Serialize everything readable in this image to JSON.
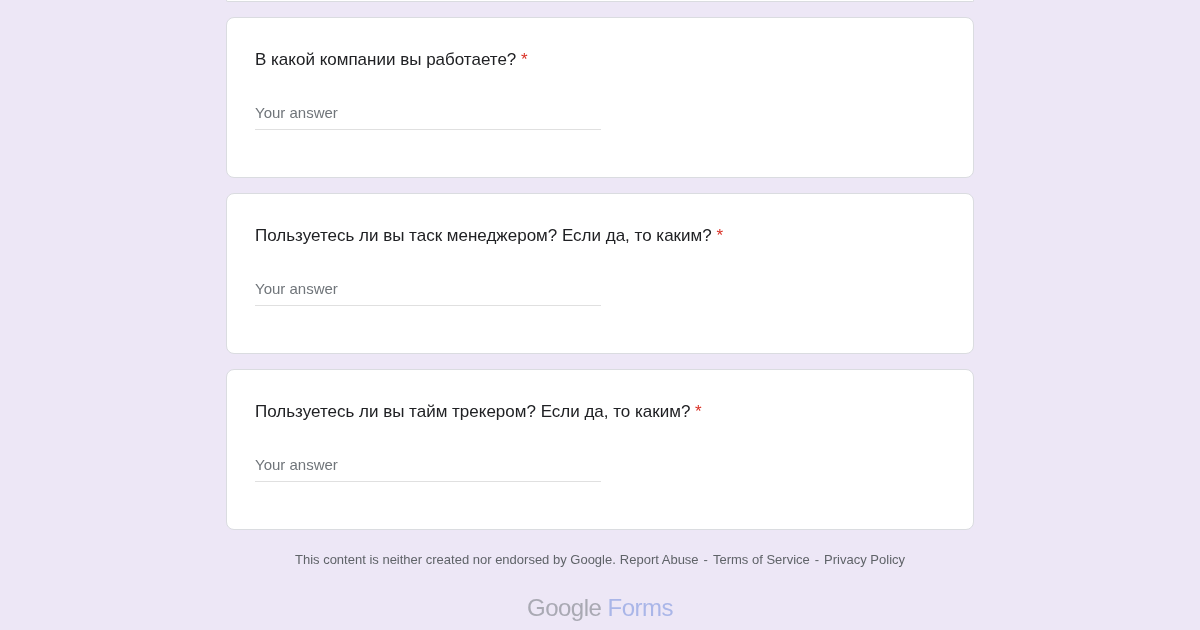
{
  "questions": [
    {
      "title": "В какой компании вы работаете?",
      "required": true,
      "placeholder": "Your answer"
    },
    {
      "title": "Пользуетесь ли вы таск менеджером? Если да, то каким?",
      "required": true,
      "placeholder": "Your answer"
    },
    {
      "title": "Пользуетесь ли вы тайм трекером? Если да, то каким?",
      "required": true,
      "placeholder": "Your answer"
    }
  ],
  "required_mark": "*",
  "footer": {
    "disclaimer": "This content is neither created nor endorsed by Google.",
    "links": [
      {
        "kind": "link",
        "text": "Report Abuse"
      },
      {
        "kind": "separator",
        "text": "-"
      },
      {
        "kind": "link",
        "text": "Terms of Service"
      },
      {
        "kind": "separator",
        "text": "-"
      },
      {
        "kind": "link",
        "text": "Privacy Policy"
      }
    ]
  },
  "logo": {
    "brand": "Google",
    "product": "Forms"
  }
}
